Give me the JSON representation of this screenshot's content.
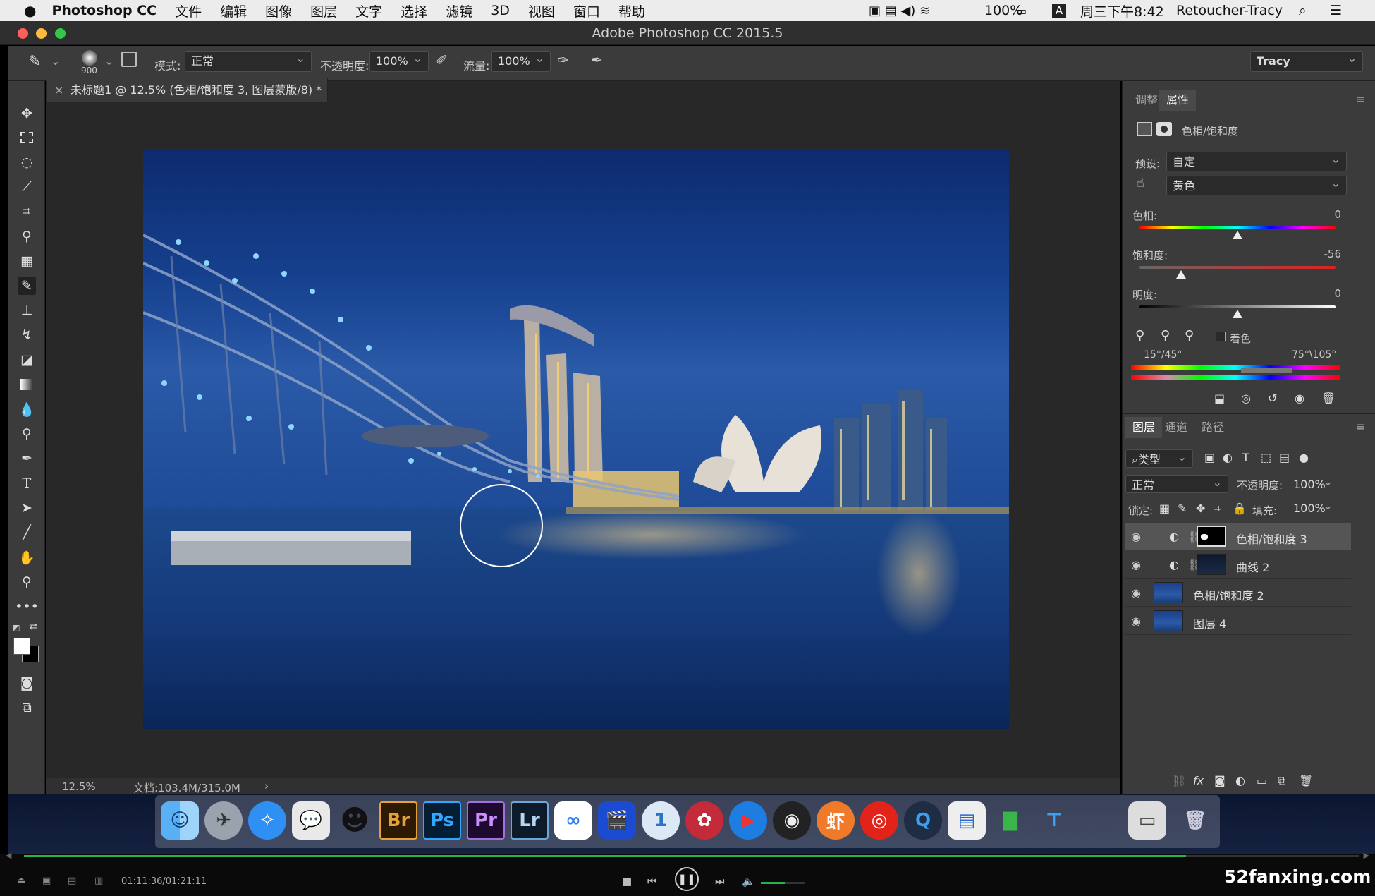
{
  "menubar": {
    "app": "Photoshop CC",
    "items": [
      "文件",
      "编辑",
      "图像",
      "图层",
      "文字",
      "选择",
      "滤镜",
      "3D",
      "视图",
      "窗口",
      "帮助"
    ],
    "battery": "100%",
    "clock": "周三下午8:42",
    "user": "Retoucher-Tracy"
  },
  "window": {
    "title": "Adobe Photoshop CC 2015.5"
  },
  "options": {
    "brush_size": "900",
    "mode_label": "模式:",
    "mode_value": "正常",
    "opacity_label": "不透明度:",
    "opacity_value": "100%",
    "flow_label": "流量:",
    "flow_value": "100%",
    "workspace": "Tracy"
  },
  "document": {
    "tab_title": "未标题1 @ 12.5% (色相/饱和度 3, 图层蒙版/8) *",
    "zoom": "12.5%",
    "doc_size": "文档:103.4M/315.0M"
  },
  "properties": {
    "tabs": [
      "调整",
      "属性"
    ],
    "active_tab": "属性",
    "title": "色相/饱和度",
    "preset_label": "预设:",
    "preset_value": "自定",
    "channel_value": "黄色",
    "hue_label": "色相:",
    "hue_value": "0",
    "saturation_label": "饱和度:",
    "saturation_value": "-56",
    "lightness_label": "明度:",
    "lightness_value": "0",
    "colorize_label": "着色",
    "range_left": "15°/45°",
    "range_right": "75°\\105°"
  },
  "layers_panel": {
    "tabs": [
      "图层",
      "通道",
      "路径"
    ],
    "filter_label": "类型",
    "blend_mode": "正常",
    "opacity_label": "不透明度:",
    "opacity_value": "100%",
    "lock_label": "锁定:",
    "fill_label": "填充:",
    "fill_value": "100%",
    "layers": [
      {
        "name": "色相/饱和度 3",
        "selected": true
      },
      {
        "name": "曲线 2",
        "selected": false
      },
      {
        "name": "色相/饱和度 2",
        "selected": false
      },
      {
        "name": "图层 4",
        "selected": false
      }
    ]
  },
  "dock": {
    "apps": [
      "Finder",
      "Launchpad",
      "Safari",
      "WeChat",
      "QQ",
      "Br",
      "Ps",
      "Pr",
      "Lr",
      "Baidu",
      "Video",
      "1Password",
      "DaVinci",
      "Player",
      "OBS",
      "Xiami",
      "NetEase",
      "QuickTime",
      "Preview",
      "Numbers",
      "Keynote",
      "Screen",
      "Trash"
    ]
  },
  "player": {
    "time": "01:11:36/01:21:11",
    "progress": 0.87,
    "volume": 0.55,
    "watermark": "52fanxing.com"
  },
  "colors": {
    "ps_blue": "#31a8ff",
    "panel_bg": "#3b3b3b",
    "doc_bg": "#282828"
  }
}
